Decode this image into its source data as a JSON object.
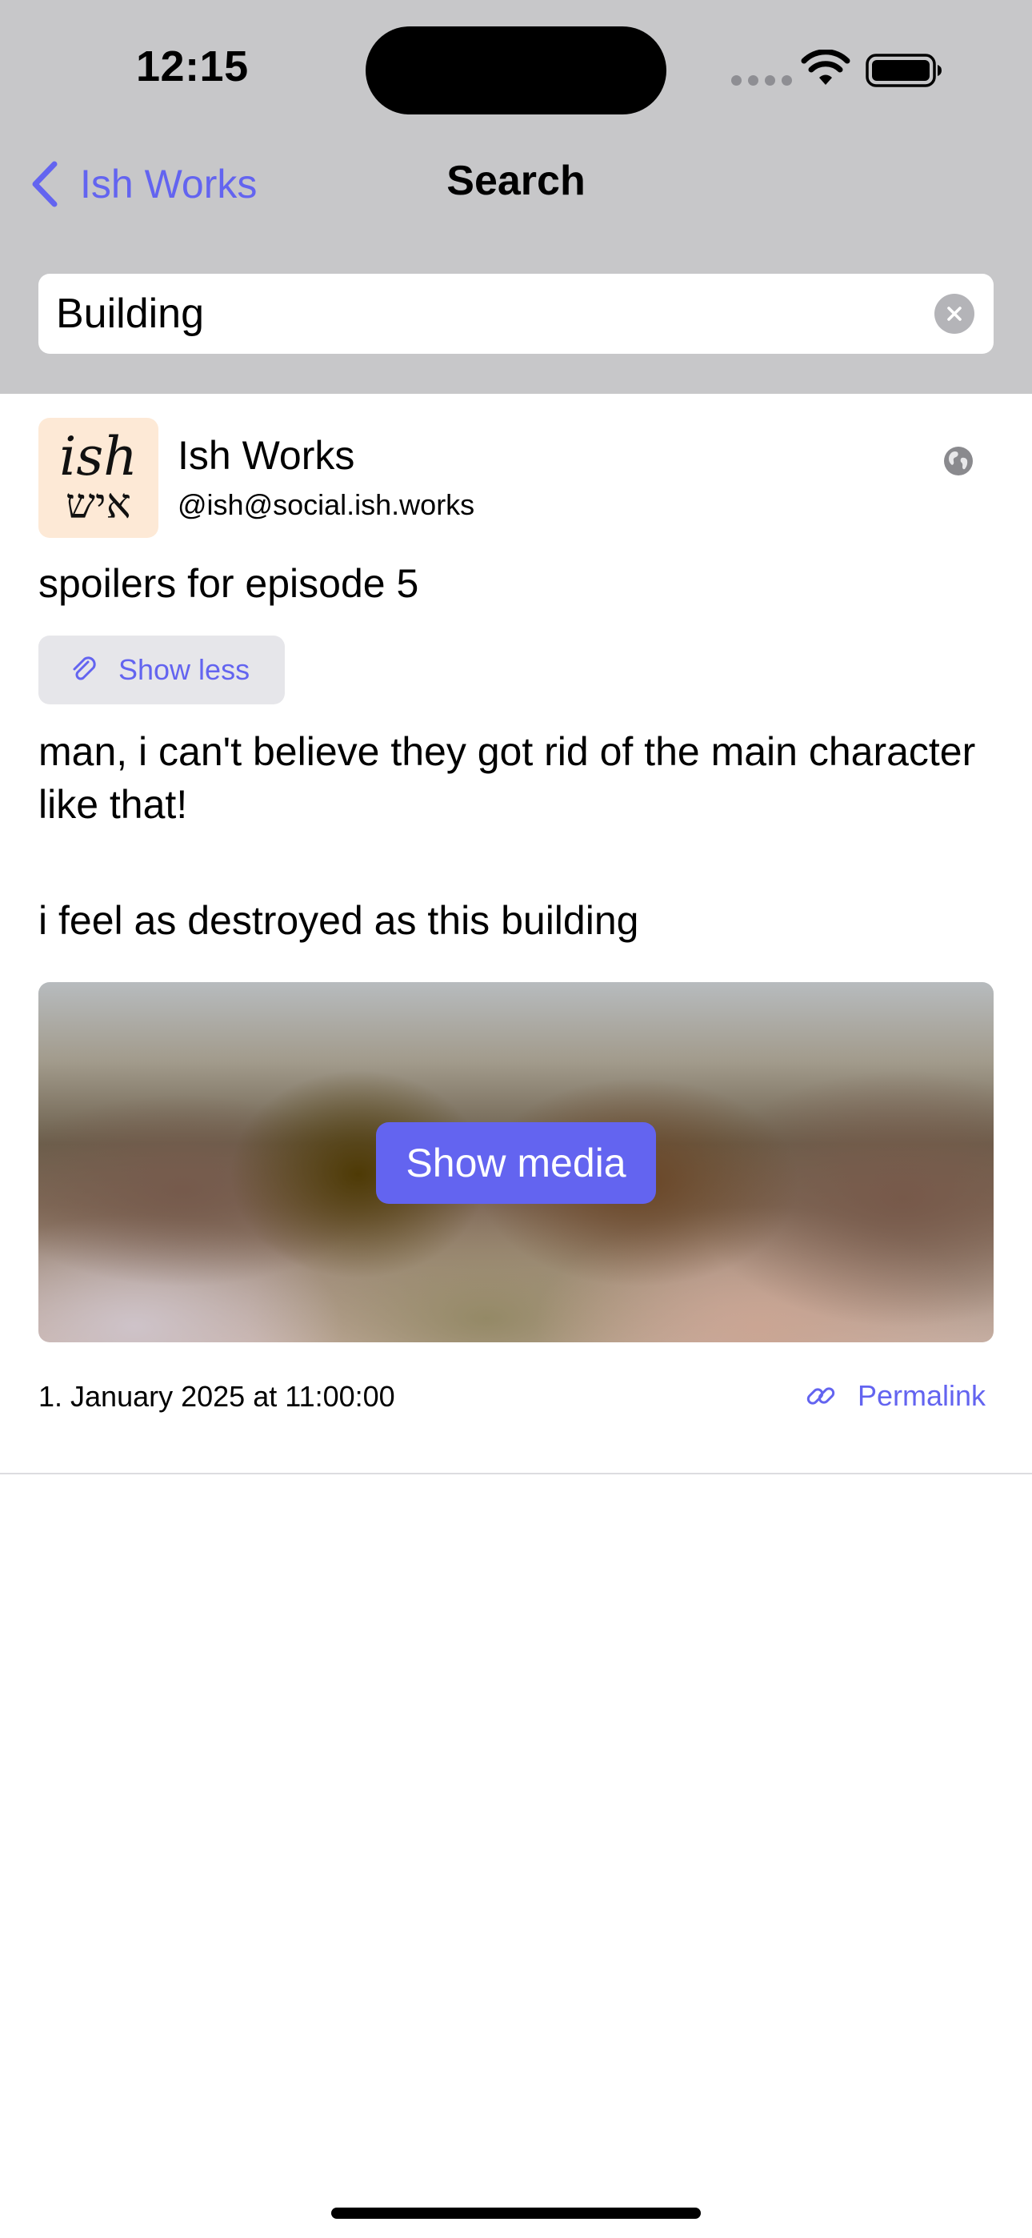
{
  "status_bar": {
    "time": "12:15"
  },
  "nav": {
    "back_label": "Ish Works",
    "title": "Search"
  },
  "search": {
    "value": "Building"
  },
  "post": {
    "avatar_latin": "ish",
    "avatar_hebrew": "איש",
    "display_name": "Ish Works",
    "handle": "@ish@social.ish.works",
    "visibility_icon": "globe-icon",
    "content_warning": "spoilers for episode 5",
    "show_less_label": "Show less",
    "body_line_1": "man, i can't believe they got rid of the main character like that!",
    "body_line_2": "i feel as destroyed as this building",
    "show_media_label": "Show media",
    "date": "1. January 2025 at 11:00:00",
    "permalink_label": "Permalink"
  },
  "colors": {
    "accent": "#6364f0",
    "header_background": "#c7c7c9",
    "button_background": "#e6e6ea"
  }
}
